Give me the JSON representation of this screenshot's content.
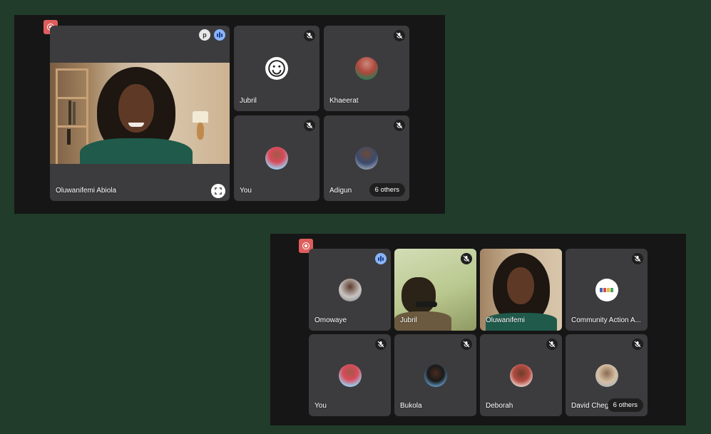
{
  "screenshot1": {
    "main_tile": {
      "name": "Oluwanifemi Abiola"
    },
    "tiles": [
      {
        "name": "Jubril"
      },
      {
        "name": "Khaeerat"
      },
      {
        "name": "You"
      },
      {
        "name": "Adigun",
        "others": "6 others"
      }
    ]
  },
  "screenshot2": {
    "tiles": [
      {
        "name": "Omowaye"
      },
      {
        "name": "Jubril"
      },
      {
        "name": "Oluwanifemi"
      },
      {
        "name": "Community Action A..."
      },
      {
        "name": "You"
      },
      {
        "name": "Bukola"
      },
      {
        "name": "Deborah"
      },
      {
        "name": "David Chege",
        "others": "6 others"
      }
    ]
  },
  "colors": {
    "page_bg": "#213c2a",
    "record": "#e05d5d",
    "tile": "#3c3c3e",
    "speaking": "#8ab4f8"
  }
}
